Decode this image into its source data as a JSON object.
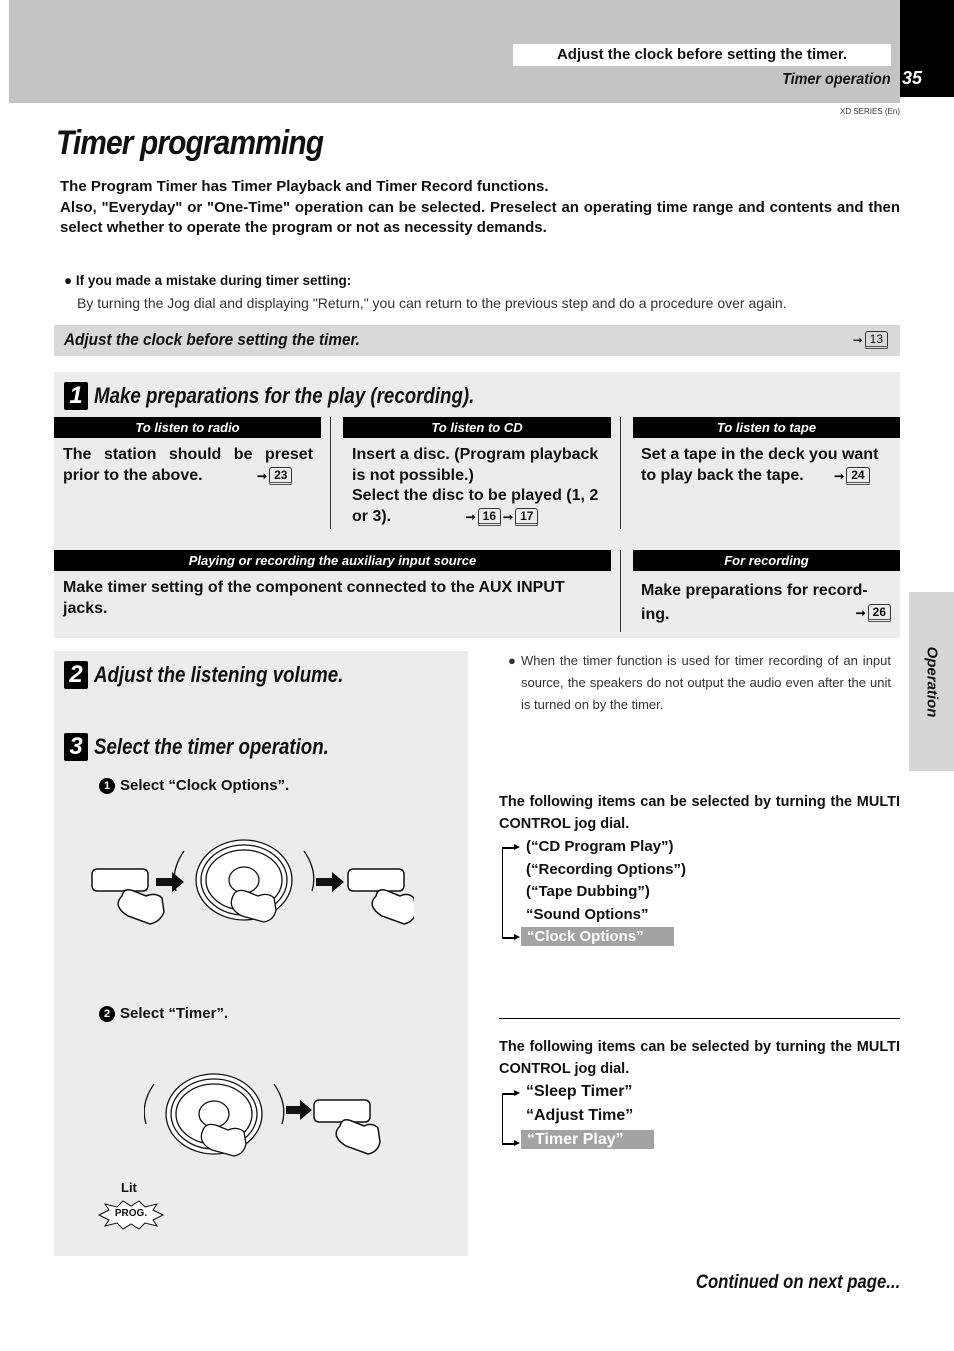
{
  "header": {
    "note": "Adjust the clock before setting the timer.",
    "section": "Timer operation",
    "page_number": "35",
    "series": "XD SERIES (En)"
  },
  "title": "Timer programming",
  "intro": {
    "line1": "The Program Timer has Timer Playback and Timer Record functions.",
    "line2": "Also, \"Everyday\" or \"One-Time\" operation can be selected.  Preselect an operating time range and contents and then select whether to operate the program or not as necessity demands."
  },
  "mistake": {
    "title": "If you made a mistake during timer setting:",
    "body": "By turning the Jog dial and displaying \"Return,\" you can return to the previous step and do a procedure over again."
  },
  "clock_bar": {
    "text": "Adjust the clock before setting the timer.",
    "ref": "13"
  },
  "step1": {
    "number": "1",
    "title": "Make preparations for the play (recording).",
    "columns": [
      {
        "head": "To listen to radio",
        "body": "The station should be preset prior to the above.",
        "refs": [
          "23"
        ]
      },
      {
        "head": "To listen to CD",
        "body": "Insert a disc. (Program playback is not possible.)",
        "body2": "Select the disc to be played (1, 2 or 3).",
        "refs": [
          "16",
          "17"
        ]
      },
      {
        "head": "To listen to tape",
        "body": "Set a tape in the deck you want to play back the tape.",
        "refs": [
          "24"
        ]
      }
    ],
    "aux": {
      "head": "Playing or recording the auxiliary input source",
      "body": "Make timer setting of the component connected to the AUX INPUT jacks."
    },
    "recording": {
      "head": "For recording",
      "body": "Make preparations for record-ing.",
      "ref": "26"
    }
  },
  "step2": {
    "number": "2",
    "title": "Adjust the listening volume."
  },
  "step3": {
    "number": "3",
    "title": "Select the timer operation.",
    "sub1": {
      "num": "1",
      "label": "Select “Clock Options”."
    },
    "sub2": {
      "num": "2",
      "label": "Select “Timer”."
    },
    "lit_label": "Lit",
    "indicator": "PROG."
  },
  "note": "When the timer function is used for timer recording of an input source, the speakers do not output the audio even after the unit is turned on by the timer.",
  "menu1": {
    "intro": "The following items can be selected by turning the MULTI CONTROL jog dial.",
    "items": [
      "(“CD Program Play”)",
      "(“Recording Options”)",
      "(“Tape Dubbing”)",
      "“Sound Options”",
      "“Clock Options”"
    ],
    "selected_index": 4
  },
  "menu2": {
    "intro": "The following items can be selected by turning the MULTI CONTROL jog dial.",
    "items": [
      "“Sleep Timer”",
      "“Adjust Time”",
      "“Timer Play”"
    ],
    "selected_index": 2
  },
  "side_tab": "Operation",
  "continued": "Continued on next page..."
}
